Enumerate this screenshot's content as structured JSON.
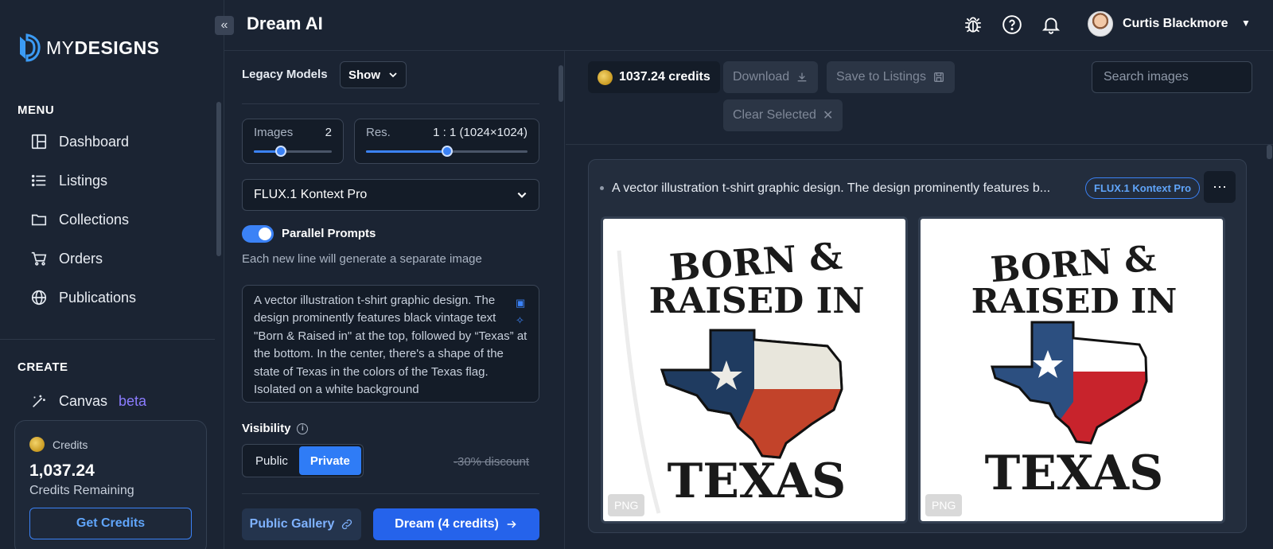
{
  "brand": {
    "logo_prefix": "MY",
    "logo_suffix": "DESIGNS"
  },
  "sidebar": {
    "menu_label": "MENU",
    "items": [
      {
        "label": "Dashboard",
        "icon": "dashboard-icon"
      },
      {
        "label": "Listings",
        "icon": "list-icon"
      },
      {
        "label": "Collections",
        "icon": "folder-icon"
      },
      {
        "label": "Orders",
        "icon": "cart-icon"
      },
      {
        "label": "Publications",
        "icon": "globe-icon"
      }
    ],
    "create_label": "CREATE",
    "canvas_label": "Canvas",
    "canvas_badge": "beta",
    "credits": {
      "title": "Credits",
      "amount": "1,037.24",
      "subtitle": "Credits Remaining",
      "button": "Get Credits"
    }
  },
  "header": {
    "title": "Dream AI",
    "collapse_icon": "«",
    "user_name": "Curtis Blackmore"
  },
  "panel": {
    "legacy_label": "Legacy Models",
    "legacy_value": "Show",
    "images": {
      "label": "Images",
      "value": "2",
      "level": 0.35
    },
    "resolution": {
      "label": "Res.",
      "value": "1 : 1 (1024×1024)",
      "level": 0.5
    },
    "model": "FLUX.1 Kontext Pro",
    "parallel_label": "Parallel Prompts",
    "parallel_on": true,
    "parallel_help": "Each new line will generate a separate image",
    "prompt": "A vector illustration t-shirt graphic design. The design prominently features black vintage text \"Born & Raised in\" at the top, followed by “Texas” at the bottom. In the center, there's a shape of the state of Texas in the colors of the Texas flag. Isolated on a white background",
    "visibility_label": "Visibility",
    "visibility_options": [
      "Public",
      "Private"
    ],
    "visibility_selected": "Private",
    "discount": "-30% discount",
    "gallery_button": "Public Gallery",
    "dream_button": "Dream (4 credits)"
  },
  "toolbar": {
    "credits": "1037.24 credits",
    "download": "Download",
    "save": "Save to Listings",
    "clear": "Clear Selected",
    "search_placeholder": "Search images"
  },
  "result": {
    "prompt": "A vector illustration t-shirt graphic design. The design prominently features b...",
    "model": "FLUX.1 Kontext Pro",
    "images": [
      {
        "line1": "BORN &",
        "line2": "RAISED IN",
        "line3": "TEXAS",
        "format": "PNG"
      },
      {
        "line1": "BORN &",
        "line2": "RAISED IN",
        "line3": "TEXAS",
        "format": "PNG"
      }
    ]
  },
  "colors": {
    "accent": "#3b82f6",
    "bg": "#1b2433",
    "texas_blue": "#2c4a73",
    "texas_red": "#c0392b"
  }
}
